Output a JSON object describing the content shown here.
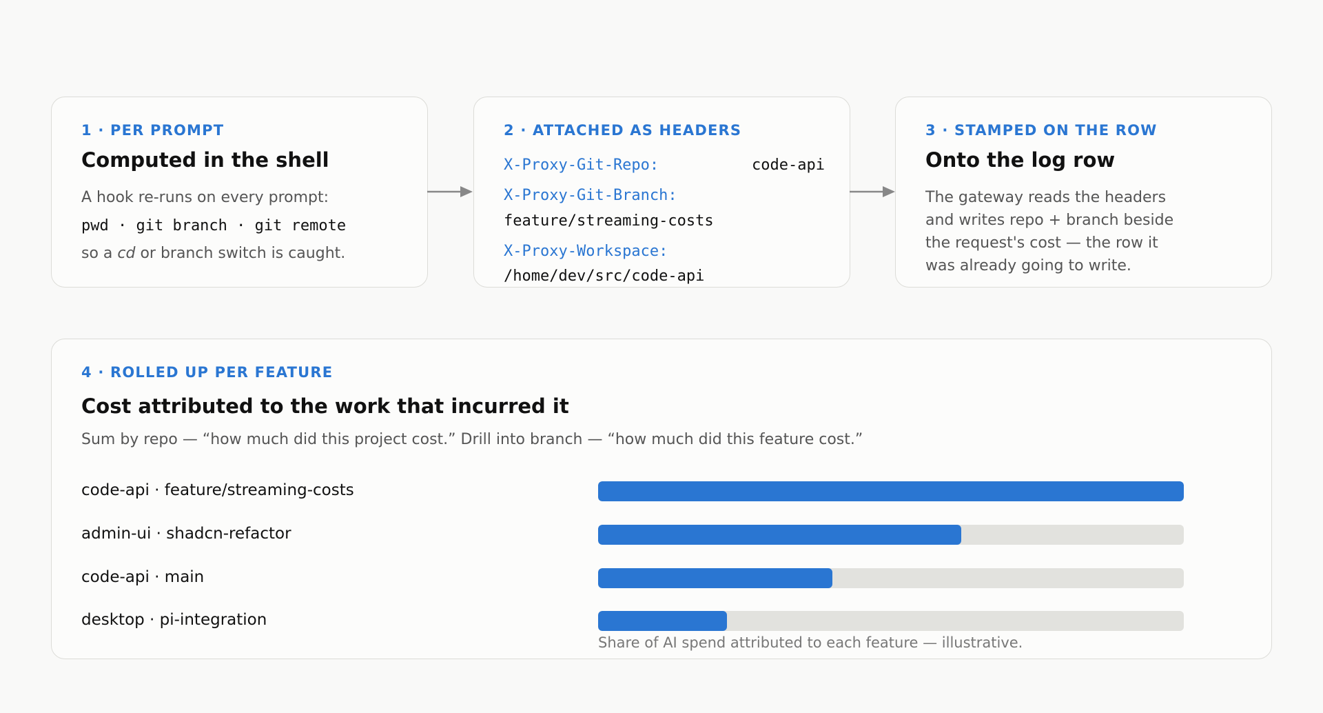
{
  "colors": {
    "accent": "#2a76d2",
    "track": "#e2e2de",
    "arrow": "#888888"
  },
  "step1": {
    "label": "1 · PER PROMPT",
    "title": "Computed in the shell",
    "line1": "A hook re-runs on every prompt:",
    "command": "pwd · git branch · git remote",
    "line3_pre": "so a ",
    "line3_em": "cd",
    "line3_post": " or branch switch is caught."
  },
  "step2": {
    "label": "2 · ATTACHED AS HEADERS",
    "headers": [
      {
        "key": "X-Proxy-Git-Repo:",
        "value": "code-api"
      },
      {
        "key": "X-Proxy-Git-Branch:",
        "value": "feature/streaming-costs"
      },
      {
        "key": "X-Proxy-Workspace:",
        "value": "/home/dev/src/code-api"
      }
    ]
  },
  "step3": {
    "label": "3 · STAMPED ON THE ROW",
    "title": "Onto the log row",
    "lines": [
      "The gateway reads the headers",
      "and writes repo + branch beside",
      "the request's cost — the row it",
      "was already going to write."
    ]
  },
  "step4": {
    "label": "4 · ROLLED UP PER FEATURE",
    "title": "Cost attributed to the work that incurred it",
    "subtitle": "Sum by repo — “how much did this project cost.” Drill into branch — “how much did this feature cost.”",
    "footnote": "Share of AI spend attributed to each feature — illustrative."
  },
  "chart_data": {
    "type": "bar",
    "orientation": "horizontal",
    "categories": [
      "code-api · feature/streaming-costs",
      "admin-ui · shadcn-refactor",
      "code-api · main",
      "desktop · pi-integration"
    ],
    "values": [
      1.0,
      0.62,
      0.4,
      0.22
    ],
    "xlim": [
      0,
      1
    ]
  }
}
